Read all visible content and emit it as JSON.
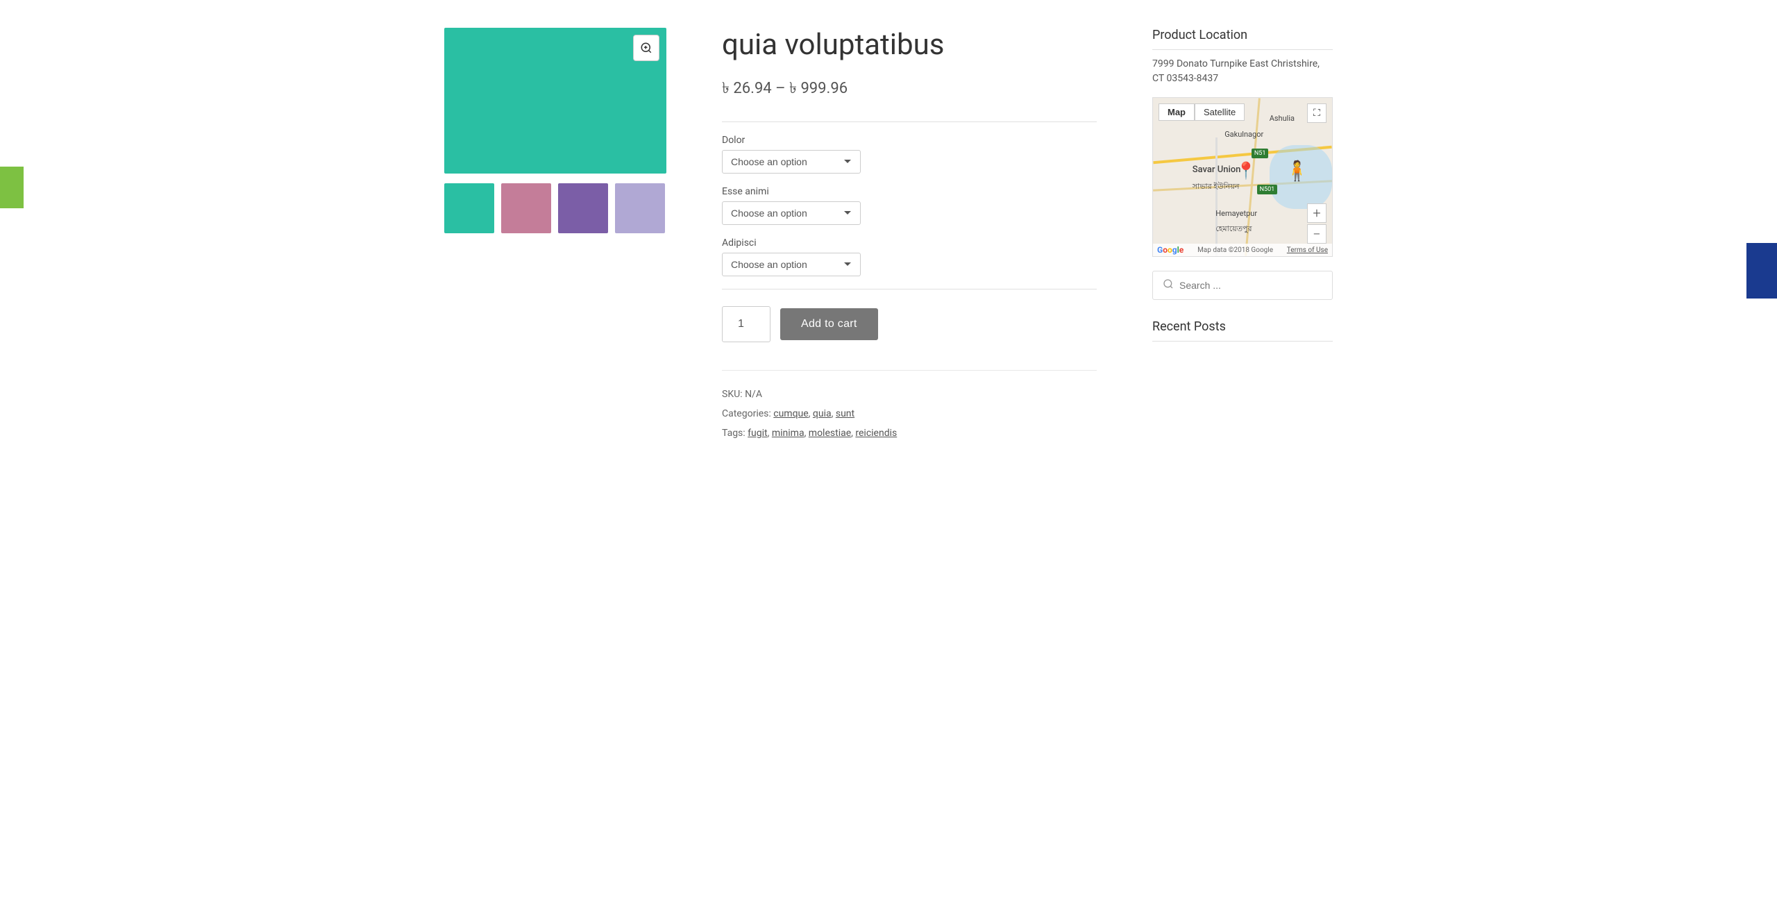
{
  "product": {
    "title": "quia voluptatibus",
    "price_range": "৳ 26.94 – ৳ 999.96",
    "sku": "N/A",
    "categories": [
      "cumque",
      "quia",
      "sunt"
    ],
    "tags": [
      "fugit",
      "minima",
      "molestiae",
      "reiciendis"
    ],
    "zoom_btn_icon": "🔍",
    "thumbnail_colors": [
      "#2abfa3",
      "#c47d99",
      "#7b5ea7",
      "#b0a8d4"
    ]
  },
  "variations": [
    {
      "label": "Dolor",
      "id": "dolor",
      "default": "Choose an option"
    },
    {
      "label": "Esse animi",
      "id": "esse_animi",
      "default": "Choose an option"
    },
    {
      "label": "Adipisci",
      "id": "adipisci",
      "default": "Choose an option"
    }
  ],
  "cart": {
    "quantity": 1,
    "add_label": "Add to cart"
  },
  "meta": {
    "sku_label": "SKU:",
    "sku_value": "N/A",
    "categories_label": "Categories:",
    "tags_label": "Tags:"
  },
  "sidebar": {
    "location_title": "Product Location",
    "address": "7999 Donato Turnpike East Christshire, CT 03543-8437",
    "map_tabs": [
      "Map",
      "Satellite"
    ],
    "map_active_tab": "Map",
    "map_fullscreen_icon": "⛶",
    "map_plus_icon": "+",
    "map_minus_icon": "−",
    "map_footer_text": "Map data ©2018 Google",
    "map_terms": "Terms of Use",
    "map_labels": [
      {
        "text": "Gakulnagor",
        "top": "22%",
        "left": "42%"
      },
      {
        "text": "Ashulia",
        "top": "12%",
        "left": "68%"
      },
      {
        "text": "Savar Union",
        "top": "45%",
        "left": "32%"
      },
      {
        "text": "সাভার ইউনিয়ন",
        "top": "55%",
        "left": "32%"
      },
      {
        "text": "Hemayetpur",
        "top": "72%",
        "left": "38%"
      },
      {
        "text": "হেমায়েতপুর",
        "top": "80%",
        "left": "38%"
      }
    ],
    "search_placeholder": "Search ...",
    "recent_posts_title": "Recent Posts"
  },
  "labels": {
    "categories_sep": ", ",
    "tags_sep": ", "
  }
}
